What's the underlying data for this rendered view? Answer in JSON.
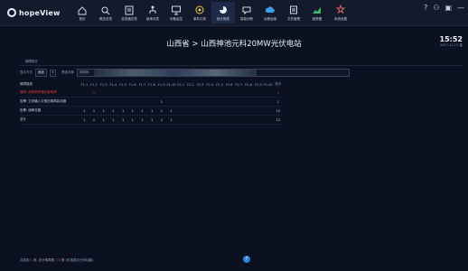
{
  "app": {
    "logo_text": "hopeView"
  },
  "nav": [
    {
      "label": "首页",
      "icon": "home-icon"
    },
    {
      "label": "概览总表",
      "icon": "overview-icon"
    },
    {
      "label": "逆变器总表",
      "icon": "inverter-list-icon"
    },
    {
      "label": "组串总表",
      "icon": "string-list-icon"
    },
    {
      "label": "设备监控",
      "icon": "monitor-icon"
    },
    {
      "label": "事件记录",
      "icon": "event-icon"
    },
    {
      "label": "统计报表",
      "icon": "report-pie-icon"
    },
    {
      "label": "智能诊断",
      "icon": "diagnosis-icon"
    },
    {
      "label": "远程运维",
      "icon": "cloud-icon"
    },
    {
      "label": "文件管理",
      "icon": "file-icon"
    },
    {
      "label": "趋势图",
      "icon": "trend-chart-icon"
    },
    {
      "label": "系统设置",
      "icon": "settings-icon"
    }
  ],
  "active_nav": 6,
  "top_icons": {
    "help": "?",
    "user": "⚇",
    "monitor": "▣",
    "close": "—"
  },
  "header": {
    "station": "山西省 > 山西神池元科20MW光伏电站",
    "time": "15:52",
    "date": "2017-11-17 星"
  },
  "breadcrumb": "故障统计",
  "filter": {
    "mode_label": "显示方式",
    "mode_value": "面板",
    "mode_arrow": "▾",
    "object_label": "筛选对象",
    "object_value": "故障码"
  },
  "table": {
    "name_header": "故障描述",
    "columns": [
      "F1-1",
      "F1-2",
      "F1-3",
      "F1-4",
      "F1-5",
      "F1-6",
      "F1-7",
      "F1-8",
      "F1-9",
      "F1-10",
      "F2-1",
      "F2-2",
      "F2-3",
      "F2-4",
      "F2-5",
      "F2-6",
      "F2-7",
      "F2-8",
      "F2-9",
      "F2-10"
    ],
    "total_header": "总计",
    "rows": [
      {
        "name": "故障: 风机故障通讯板故障",
        "red": true,
        "cells": [
          "",
          "1",
          "",
          "",
          "",
          "",
          "",
          "",
          "",
          "",
          "",
          "",
          "",
          "",
          "",
          "",
          "",
          "",
          "",
          "",
          ""
        ],
        "total": "1"
      },
      {
        "name": "告警: 交流输入欠电压故障启动报",
        "red": false,
        "cells": [
          "",
          "",
          "",
          "",
          "",
          "",
          "",
          "",
          "1",
          "",
          "",
          "",
          "",
          "",
          "",
          "",
          "",
          "",
          "",
          ""
        ],
        "total": "1"
      },
      {
        "name": "告警: 组串支路",
        "red": false,
        "cells": [
          "1",
          "1",
          "1",
          "1",
          "1",
          "1",
          "1",
          "1",
          "1",
          "1",
          "",
          "",
          "",
          "",
          "",
          "",
          "",
          "",
          "",
          ""
        ],
        "total": "10"
      },
      {
        "name": "总计",
        "red": false,
        "cells": [
          "1",
          "2",
          "1",
          "1",
          "1",
          "1",
          "1",
          "1",
          "2",
          "1",
          "",
          "",
          "",
          "",
          "",
          "",
          "",
          "",
          "",
          ""
        ],
        "total": "12"
      }
    ]
  },
  "footer": {
    "prefix": "共找到 ",
    "count": "1",
    "sep": " 条, 总计故障数 ",
    "faults": "3.8",
    "suffix": " 条 (可选显示分页功能)"
  },
  "help_btn": "?"
}
